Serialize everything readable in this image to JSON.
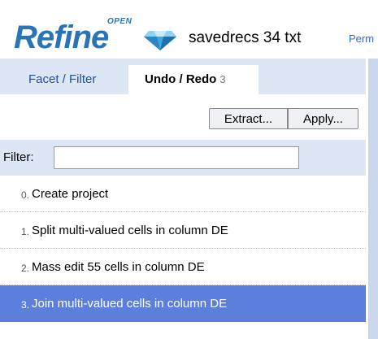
{
  "header": {
    "logo_text": "Refine",
    "logo_superscript": "OPEN",
    "project_name": "savedrecs 34 txt",
    "permalink_label": "Perm"
  },
  "tabs": [
    {
      "label": "Facet / Filter",
      "active": false
    },
    {
      "label": "Undo / Redo",
      "count": "3",
      "active": true
    }
  ],
  "toolbar": {
    "extract_label": "Extract...",
    "apply_label": "Apply..."
  },
  "filter": {
    "label": "Filter:",
    "value": "",
    "placeholder": ""
  },
  "history": [
    {
      "index": "0.",
      "text": "Create project"
    },
    {
      "index": "1.",
      "text": "Split multi-valued cells in column DE"
    },
    {
      "index": "2.",
      "text": "Mass edit 55 cells in column DE"
    },
    {
      "index": "3.",
      "text": "Join multi-valued cells in column DE",
      "active": true
    }
  ],
  "colors": {
    "brand": "#2a74b6",
    "panel_background": "#dde6f5",
    "active_row": "#5d7fdc",
    "link": "#3366cc"
  },
  "icons": {
    "logo": "diamond-icon"
  }
}
